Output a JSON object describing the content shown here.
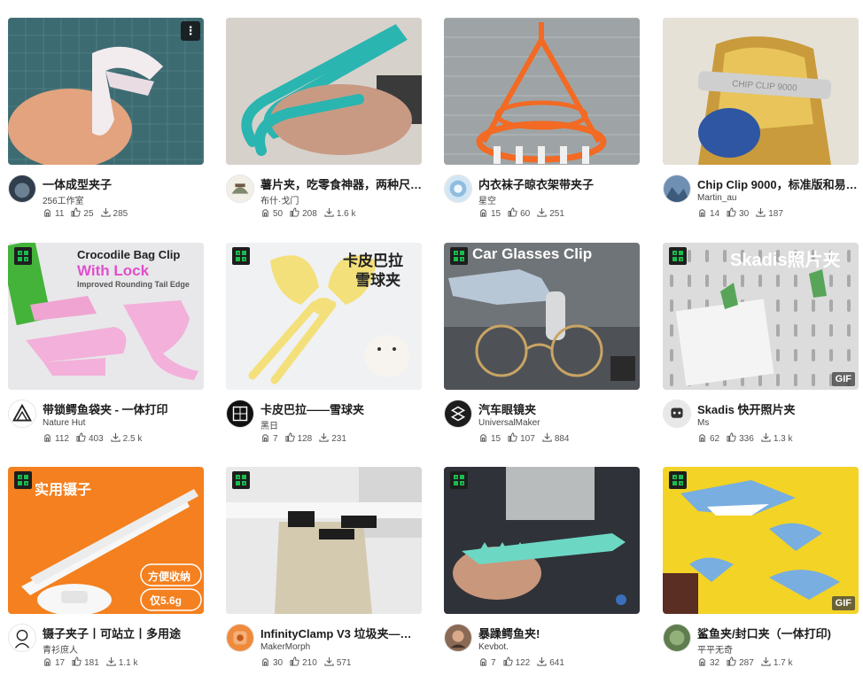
{
  "colors": {
    "accent": "#19bd4e",
    "text": "#1c1c1c",
    "muted": "#555555"
  },
  "cards": [
    {
      "title": "一体成型夹子",
      "author": "256工作室",
      "boosts": "11",
      "likes": "25",
      "downloads": "285",
      "thumb": "white-clip",
      "more": "⋮"
    },
    {
      "title": "薯片夹，吃零食神器，两种尺…",
      "author": "布什·戈门",
      "boosts": "50",
      "likes": "208",
      "downloads": "1.6 k",
      "thumb": "teal-tweezer"
    },
    {
      "title": "内衣袜子晾衣架带夹子",
      "author": "星空",
      "boosts": "15",
      "likes": "60",
      "downloads": "251",
      "thumb": "orange-hanger"
    },
    {
      "title": "Chip Clip 9000，标准版和易…",
      "author": "Martin_au",
      "boosts": "14",
      "likes": "30",
      "downloads": "187",
      "thumb": "chip-bag",
      "caption": "CHIP CLIP 9000"
    },
    {
      "title": "带锁鳄鱼袋夹 - 一体打印",
      "author": "Nature Hut",
      "boosts": "112",
      "likes": "403",
      "downloads": "2.5 k",
      "thumb": "croc-pink",
      "caption": "Crocodile Bag Clip",
      "caption2": "With Lock",
      "caption3": "Improved Rounding Tail Edge"
    },
    {
      "title": "卡皮巴拉——雪球夹",
      "author": "黑日",
      "boosts": "7",
      "likes": "128",
      "downloads": "231",
      "thumb": "capy",
      "caption": "卡皮巴拉",
      "caption2": "雪球夹"
    },
    {
      "title": "汽车眼镜夹",
      "author": "UniversalMaker",
      "boosts": "15",
      "likes": "107",
      "downloads": "884",
      "thumb": "glasses",
      "caption": "Car Glasses Clip"
    },
    {
      "title": "Skadis 快开照片夹",
      "author": "Ms",
      "boosts": "62",
      "likes": "336",
      "downloads": "1.3 k",
      "thumb": "skadis",
      "caption": "Skadis照片夹",
      "gif": "GIF"
    },
    {
      "title": "镊子夹子丨可站立丨多用途",
      "author": "青衫庶人",
      "boosts": "17",
      "likes": "181",
      "downloads": "1.1 k",
      "thumb": "tweezers",
      "caption": "实用镊子",
      "caption2": "方便收纳",
      "caption3": "仅5.6g"
    },
    {
      "title": "InfinityClamp V3 垃圾夹—…",
      "author": "MakerMorph",
      "boosts": "30",
      "likes": "210",
      "downloads": "571",
      "thumb": "trash"
    },
    {
      "title": "暴躁鳄鱼夹!",
      "author": "Kevbot.",
      "boosts": "7",
      "likes": "122",
      "downloads": "641",
      "thumb": "croc-teal"
    },
    {
      "title": "鲨鱼夹/封口夹（一体打印)",
      "author": "平平无奇",
      "boosts": "32",
      "likes": "287",
      "downloads": "1.7 k",
      "thumb": "sharks",
      "gif": "GIF"
    }
  ]
}
